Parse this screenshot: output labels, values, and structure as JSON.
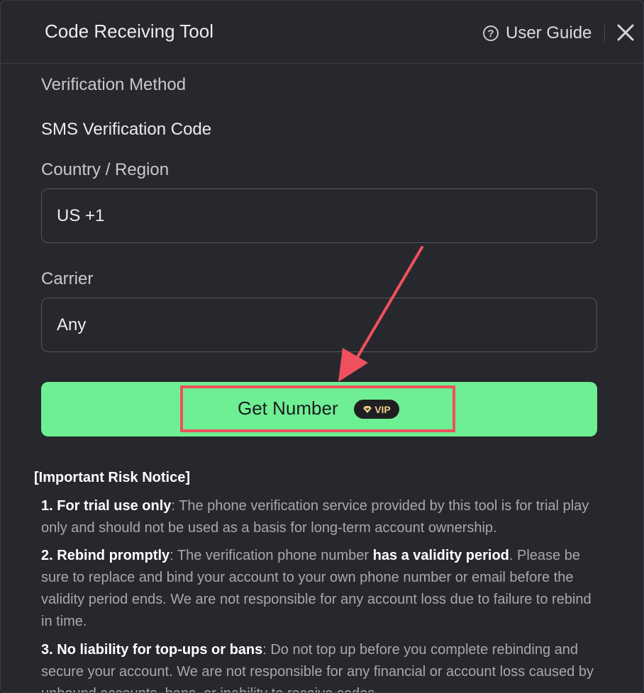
{
  "header": {
    "title": "Code Receiving Tool",
    "guide_label": "User Guide",
    "help_icon": "question-circle-icon",
    "close_icon": "close-icon"
  },
  "form": {
    "method_label": "Verification Method",
    "method_value": "SMS Verification Code",
    "country_label": "Country / Region",
    "country_value": "US +1",
    "carrier_label": "Carrier",
    "carrier_value": "Any",
    "submit_label": "Get Number",
    "vip_badge": "VIP"
  },
  "notice": {
    "title": "[Important Risk Notice]",
    "items": [
      {
        "prefix": "1. ",
        "bold": "For trial use only",
        "text": ": The phone verification service provided by this tool is for trial play only and should not be used as a basis for long-term account ownership."
      },
      {
        "prefix": "2. ",
        "bold": "Rebind promptly",
        "text_a": ": The verification phone number ",
        "bold_b": "has a validity period",
        "text_b": ". Please be sure to replace and bind your account to your own phone number or email before the validity period ends. We are not responsible for any account loss due to failure to rebind in time."
      },
      {
        "prefix": "3. ",
        "bold": "No liability for top-ups or bans",
        "text": ": Do not top up before you complete rebinding and secure your account. We are not responsible for any financial or account loss caused by unbound accounts, bans, or inability to receive codes."
      }
    ]
  },
  "colors": {
    "background": "#27282e",
    "accent_green": "#6fef93",
    "highlight_red": "#f0505e"
  }
}
